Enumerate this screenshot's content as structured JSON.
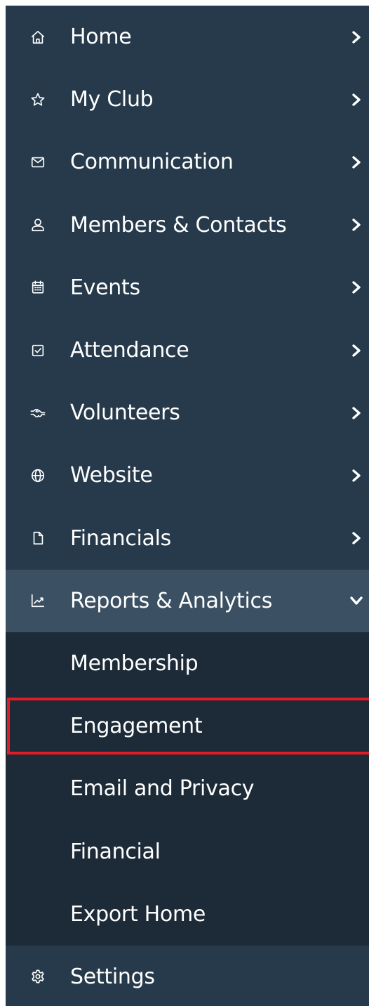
{
  "nav": {
    "items": [
      {
        "label": "Home",
        "icon": "home-icon"
      },
      {
        "label": "My Club",
        "icon": "star-icon"
      },
      {
        "label": "Communication",
        "icon": "envelope-icon"
      },
      {
        "label": "Members & Contacts",
        "icon": "person-icon"
      },
      {
        "label": "Events",
        "icon": "calendar-icon"
      },
      {
        "label": "Attendance",
        "icon": "checkbox-icon"
      },
      {
        "label": "Volunteers",
        "icon": "handshake-icon"
      },
      {
        "label": "Website",
        "icon": "globe-icon"
      },
      {
        "label": "Financials",
        "icon": "document-icon"
      },
      {
        "label": "Reports & Analytics",
        "icon": "chart-icon",
        "expanded": true
      }
    ],
    "submenu": [
      {
        "label": "Membership"
      },
      {
        "label": "Engagement",
        "highlighted": true
      },
      {
        "label": "Email and Privacy"
      },
      {
        "label": "Financial"
      },
      {
        "label": "Export Home"
      }
    ],
    "footer": {
      "label": "Settings",
      "icon": "gear-icon"
    }
  },
  "colors": {
    "sidebar_bg": "#263a4b",
    "expanded_bg": "#3b5062",
    "submenu_bg": "#1d2b38",
    "highlight_border": "#e31b23",
    "text": "#ffffff"
  }
}
